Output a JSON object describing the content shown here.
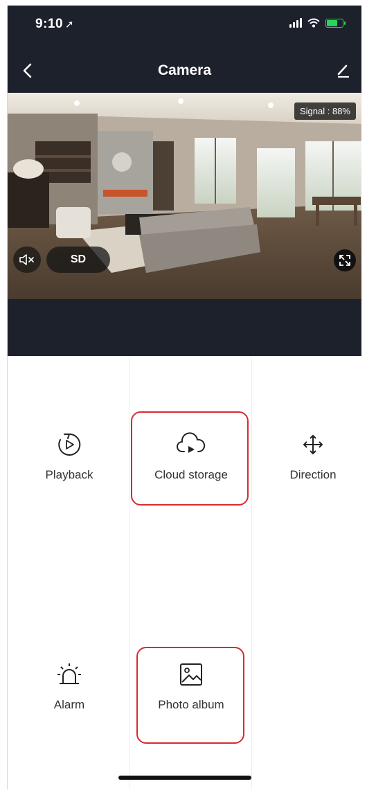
{
  "status_bar": {
    "time": "9:10",
    "location_arrow": "➚"
  },
  "nav": {
    "title": "Camera"
  },
  "video": {
    "signal_label": "Signal : 88%",
    "quality_label": "SD"
  },
  "features": [
    {
      "label": "Playback",
      "icon": "playback-icon"
    },
    {
      "label": "Cloud storage",
      "icon": "cloud-storage-icon"
    },
    {
      "label": "Direction",
      "icon": "direction-icon"
    },
    {
      "label": "Alarm",
      "icon": "alarm-icon"
    },
    {
      "label": "Photo album",
      "icon": "photo-album-icon"
    }
  ],
  "colors": {
    "dark_bg": "#1d212b",
    "highlight": "#d72a33",
    "battery": "#2bd45a"
  }
}
